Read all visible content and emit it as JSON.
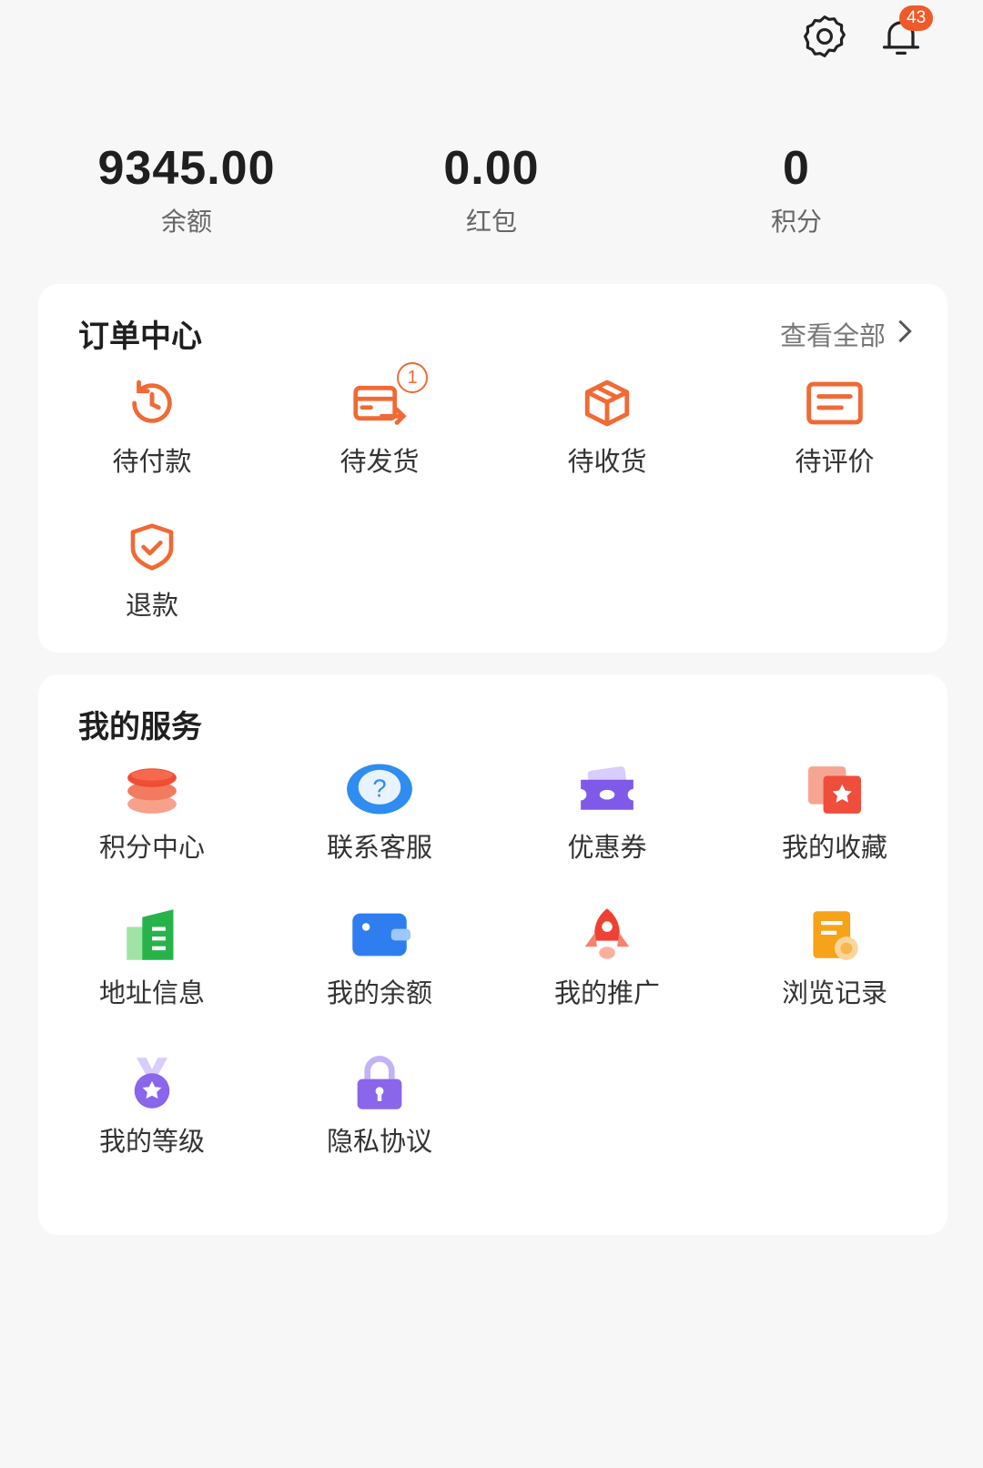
{
  "header": {
    "settings_icon": "gear-icon",
    "notification_icon": "bell-icon",
    "notification_count": "43"
  },
  "stats": [
    {
      "value": "9345.00",
      "label": "余额"
    },
    {
      "value": "0.00",
      "label": "红包"
    },
    {
      "value": "0",
      "label": "积分"
    }
  ],
  "orders": {
    "title": "订单中心",
    "view_all": "查看全部",
    "items": [
      {
        "label": "待付款",
        "icon": "clock-refresh-icon"
      },
      {
        "label": "待发货",
        "icon": "card-send-icon",
        "badge": "1"
      },
      {
        "label": "待收货",
        "icon": "package-box-icon"
      },
      {
        "label": "待评价",
        "icon": "comment-list-icon"
      },
      {
        "label": "退款",
        "icon": "shield-check-icon"
      }
    ],
    "accent": "#f06a35"
  },
  "services": {
    "title": "我的服务",
    "items": [
      {
        "label": "积分中心",
        "icon": "coins-stack-icon"
      },
      {
        "label": "联系客服",
        "icon": "help-chat-icon"
      },
      {
        "label": "优惠券",
        "icon": "coupon-ticket-icon"
      },
      {
        "label": "我的收藏",
        "icon": "favorite-star-icon"
      },
      {
        "label": "地址信息",
        "icon": "address-book-icon"
      },
      {
        "label": "我的余额",
        "icon": "wallet-icon"
      },
      {
        "label": "我的推广",
        "icon": "rocket-icon"
      },
      {
        "label": "浏览记录",
        "icon": "history-doc-icon"
      },
      {
        "label": "我的等级",
        "icon": "level-medal-icon"
      },
      {
        "label": "隐私协议",
        "icon": "privacy-lock-icon"
      }
    ]
  }
}
